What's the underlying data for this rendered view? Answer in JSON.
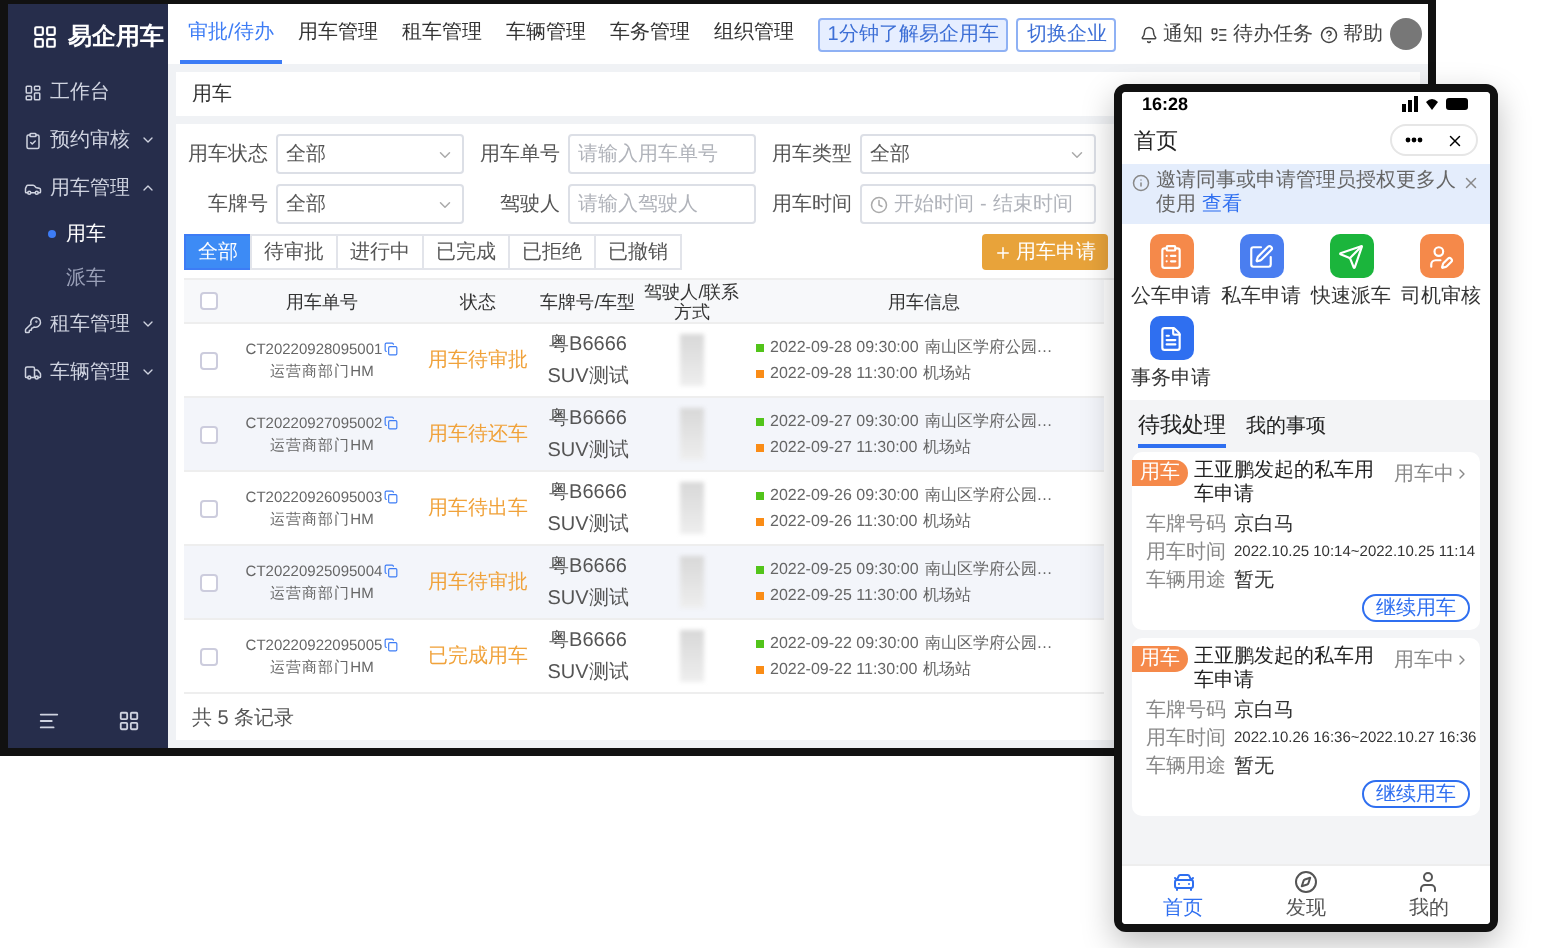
{
  "desktop": {
    "brand": "易企用车",
    "sidebar": [
      {
        "kind": "link",
        "label": "工作台"
      },
      {
        "kind": "group",
        "label": "预约审核",
        "expanded": false
      },
      {
        "kind": "group",
        "label": "用车管理",
        "expanded": true,
        "children": [
          {
            "label": "用车",
            "selected": true
          },
          {
            "label": "派车",
            "selected": false
          }
        ]
      },
      {
        "kind": "group",
        "label": "租车管理",
        "expanded": false
      },
      {
        "kind": "group",
        "label": "车辆管理",
        "expanded": false
      }
    ],
    "nav_tabs": [
      {
        "label": "审批/待办",
        "selected": true
      },
      {
        "label": "用车管理",
        "selected": false
      },
      {
        "label": "租车管理",
        "selected": false
      },
      {
        "label": "车辆管理",
        "selected": false
      },
      {
        "label": "车务管理",
        "selected": false
      },
      {
        "label": "组织管理",
        "selected": false
      }
    ],
    "header_buttons": [
      "1分钟了解易企用车",
      "切换企业"
    ],
    "header_links": [
      "通知",
      "待办任务",
      "帮助"
    ],
    "breadcrumb": "用车",
    "filters": [
      {
        "kind": "select",
        "label": "用车状态",
        "value": "全部"
      },
      {
        "kind": "input",
        "label": "用车单号",
        "placeholder": "请输入用车单号"
      },
      {
        "kind": "select",
        "label": "用车类型",
        "value": "全部"
      },
      {
        "kind": "select",
        "label": "车牌号",
        "value": "全部"
      },
      {
        "kind": "input",
        "label": "驾驶人",
        "placeholder": "请输入驾驶人"
      },
      {
        "kind": "daterange",
        "label": "用车时间",
        "start_placeholder": "开始时间",
        "separator": "-",
        "end_placeholder": "结束时间"
      }
    ],
    "status_tabs": [
      {
        "label": "全部",
        "selected": true
      },
      {
        "label": "待审批",
        "selected": false
      },
      {
        "label": "进行中",
        "selected": false
      },
      {
        "label": "已完成",
        "selected": false
      },
      {
        "label": "已拒绝",
        "selected": false
      },
      {
        "label": "已撤销",
        "selected": false
      }
    ],
    "add_button": "用车申请",
    "table": {
      "select_all_checked": false,
      "columns": [
        "用车单号",
        "状态",
        "车牌号/车型",
        "驾驶人/联系方式",
        "用车信息"
      ],
      "rows": [
        {
          "checked": false,
          "order_no": "CT20220928095001",
          "dept": "运营商部门HM",
          "status": "用车待审批",
          "plate": "粤B6666",
          "model": "SUV测试",
          "events": [
            {
              "color": "#52c41a",
              "time": "2022-09-28 09:30:00",
              "place": "南山区学府公园…"
            },
            {
              "color": "#fa8c16",
              "time": "2022-09-28 11:30:00",
              "place": "机场站"
            }
          ]
        },
        {
          "checked": false,
          "order_no": "CT20220927095002",
          "dept": "运营商部门HM",
          "status": "用车待还车",
          "plate": "粤B6666",
          "model": "SUV测试",
          "events": [
            {
              "color": "#52c41a",
              "time": "2022-09-27 09:30:00",
              "place": "南山区学府公园…"
            },
            {
              "color": "#fa8c16",
              "time": "2022-09-27 11:30:00",
              "place": "机场站"
            }
          ]
        },
        {
          "checked": false,
          "order_no": "CT20220926095003",
          "dept": "运营商部门HM",
          "status": "用车待出车",
          "plate": "粤B6666",
          "model": "SUV测试",
          "events": [
            {
              "color": "#52c41a",
              "time": "2022-09-26 09:30:00",
              "place": "南山区学府公园…"
            },
            {
              "color": "#fa8c16",
              "time": "2022-09-26 11:30:00",
              "place": "机场站"
            }
          ]
        },
        {
          "checked": false,
          "order_no": "CT20220925095004",
          "dept": "运营商部门HM",
          "status": "用车待审批",
          "plate": "粤B6666",
          "model": "SUV测试",
          "events": [
            {
              "color": "#52c41a",
              "time": "2022-09-25 09:30:00",
              "place": "南山区学府公园…"
            },
            {
              "color": "#fa8c16",
              "time": "2022-09-25 11:30:00",
              "place": "机场站"
            }
          ]
        },
        {
          "checked": false,
          "order_no": "CT20220922095005",
          "dept": "运营商部门HM",
          "status": "已完成用车",
          "plate": "粤B6666",
          "model": "SUV测试",
          "events": [
            {
              "color": "#52c41a",
              "time": "2022-09-22 09:30:00",
              "place": "南山区学府公园…"
            },
            {
              "color": "#fa8c16",
              "time": "2022-09-22 11:30:00",
              "place": "机场站"
            }
          ]
        }
      ]
    },
    "footer": "共 5 条记录"
  },
  "phone": {
    "time": "16:28",
    "title": "首页",
    "notice": {
      "text": "邀请同事或申请管理员授权更多人使用",
      "link": "查看"
    },
    "apps": [
      {
        "label": "公车申请",
        "color": "#f5894a"
      },
      {
        "label": "私车申请",
        "color": "#4a7ef0"
      },
      {
        "label": "快速派车",
        "color": "#1bb53c"
      },
      {
        "label": "司机审核",
        "color": "#f5894a"
      },
      {
        "label": "事务申请",
        "color": "#2f6ff0"
      }
    ],
    "tabs": [
      {
        "label": "待我处理",
        "selected": true
      },
      {
        "label": "我的事项",
        "selected": false
      }
    ],
    "cards": [
      {
        "tag": "用车",
        "title": "王亚鹏发起的私车用车申请",
        "status": "用车中",
        "fields": [
          {
            "label": "车牌号码",
            "value": "京白马"
          },
          {
            "label": "用车时间",
            "value": "2022.10.25 10:14~2022.10.25 11:14"
          },
          {
            "label": "车辆用途",
            "value": "暂无"
          }
        ],
        "action": "继续用车"
      },
      {
        "tag": "用车",
        "title": "王亚鹏发起的私车用车申请",
        "status": "用车中",
        "fields": [
          {
            "label": "车牌号码",
            "value": "京白马"
          },
          {
            "label": "用车时间",
            "value": "2022.10.26 16:36~2022.10.27 16:36"
          },
          {
            "label": "车辆用途",
            "value": "暂无"
          }
        ],
        "action": "继续用车"
      }
    ],
    "bottom_nav": [
      {
        "label": "首页",
        "selected": true
      },
      {
        "label": "发现",
        "selected": false
      },
      {
        "label": "我的",
        "selected": false
      }
    ]
  }
}
